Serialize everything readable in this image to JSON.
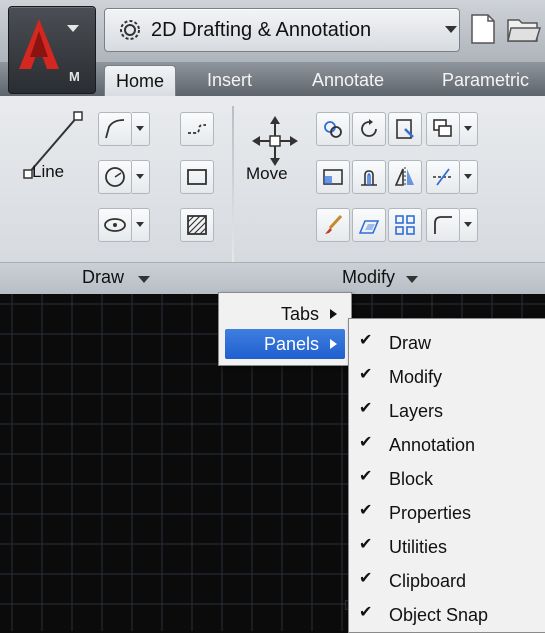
{
  "app": {
    "menu_letter": "M"
  },
  "workspace": {
    "label": "2D Drafting & Annotation"
  },
  "tabs": [
    "Home",
    "Insert",
    "Annotate",
    "Parametric"
  ],
  "ribbon": {
    "draw_panel": {
      "title": "Draw",
      "line_label": "Line"
    },
    "modify_panel": {
      "title": "Modify",
      "move_label": "Move"
    }
  },
  "context_menu": {
    "items": [
      {
        "label": "Tabs",
        "has_submenu": true
      },
      {
        "label": "Panels",
        "has_submenu": true,
        "highlighted": true
      }
    ]
  },
  "panels_submenu": {
    "items": [
      {
        "label": "Draw",
        "checked": true
      },
      {
        "label": "Modify",
        "checked": true
      },
      {
        "label": "Layers",
        "checked": true
      },
      {
        "label": "Annotation",
        "checked": true
      },
      {
        "label": "Block",
        "checked": true
      },
      {
        "label": "Properties",
        "checked": true
      },
      {
        "label": "Utilities",
        "checked": true
      },
      {
        "label": "Clipboard",
        "checked": true
      },
      {
        "label": "Object Snap",
        "checked": true
      }
    ],
    "checkmark": "✔"
  },
  "colors": {
    "highlight": "#2f6fd8",
    "ribbon": "#e1e4e8",
    "canvas": "#0b0b0b"
  }
}
